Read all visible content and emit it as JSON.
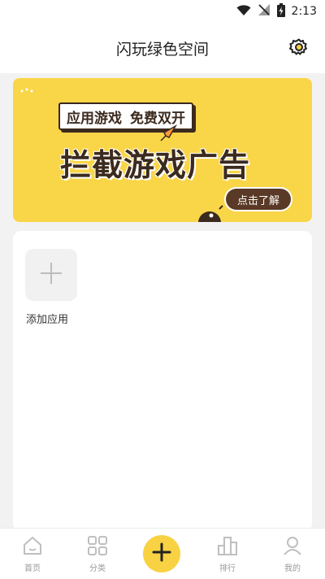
{
  "status_bar": {
    "time": "2:13"
  },
  "header": {
    "title": "闪玩绿色空间"
  },
  "banner": {
    "tag_left": "应用游戏",
    "tag_right": "免费双开",
    "headline": "拦截游戏广告",
    "cta": "点击了解"
  },
  "content": {
    "add_app_label": "添加应用"
  },
  "bottom_nav": {
    "items": [
      {
        "label": "首页"
      },
      {
        "label": "分类"
      },
      {
        "label": "排行"
      },
      {
        "label": "我的"
      }
    ]
  },
  "colors": {
    "accent": "#f8d243",
    "banner_bg": "#f9d548",
    "banner_text": "#3b2a1e",
    "cta_bg": "#5a3a26",
    "page_bg": "#f2f2f2"
  }
}
